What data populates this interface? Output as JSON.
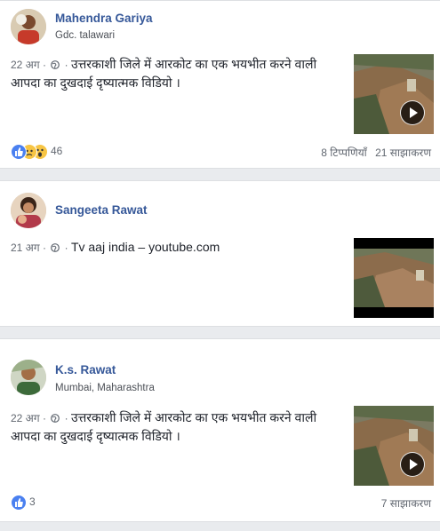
{
  "posts": [
    {
      "author": "Mahendra Gariya",
      "subtitle": "Gdc. talawari",
      "date": "22 अग",
      "text": "उत्तरकाशी जिले में आरकोट का एक भयभीत करने वाली आपदा का दुखदाई दृष्यात्मक विडियो ।",
      "reaction_count": "46",
      "reactions": [
        "like-icon",
        "sad-icon",
        "wow-icon"
      ],
      "comments": "8 टिप्पणियाँ",
      "shares": "21 साझाकरण"
    },
    {
      "author": "Sangeeta Rawat",
      "date": "21 अग",
      "text": "Tv aaj india – youtube.com"
    },
    {
      "author": "K.s. Rawat",
      "subtitle": "Mumbai, Maharashtra",
      "date": "22 अग",
      "text": "उत्तरकाशी जिले में आरकोट का एक भयभीत करने वाली आपदा का दुखदाई दृष्यात्मक विडियो ।",
      "reaction_count": "3",
      "reactions": [
        "like-icon"
      ],
      "shares": "7 साझाकरण"
    }
  ],
  "colors": {
    "name": "#365899",
    "like": "#4a80f0",
    "meta": "#616770",
    "background": "#e9ebee"
  }
}
